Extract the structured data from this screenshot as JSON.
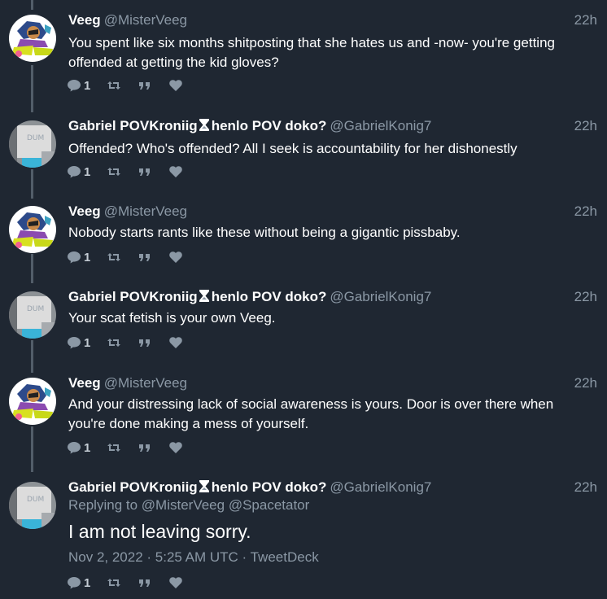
{
  "tweets": [
    {
      "author": "Veeg",
      "handle": "@MisterVeeg",
      "time": "22h",
      "text": "You spent like six months shitposting that she hates us and -now- you're getting offended at getting the kid gloves?",
      "reply_count": "1",
      "avatar": "veeg"
    },
    {
      "author": "Gabriel POVKroniig",
      "author_suffix": "henlo POV doko?",
      "handle": "@GabrielKonig7",
      "time": "22h",
      "text": "Offended? Who's offended? All I seek is accountability for her dishonestly",
      "reply_count": "1",
      "avatar": "gabriel"
    },
    {
      "author": "Veeg",
      "handle": "@MisterVeeg",
      "time": "22h",
      "text": "Nobody starts rants like these without being a gigantic pissbaby.",
      "reply_count": "1",
      "avatar": "veeg"
    },
    {
      "author": "Gabriel POVKroniig",
      "author_suffix": "henlo POV doko?",
      "handle": "@GabrielKonig7",
      "time": "22h",
      "text": "Your scat fetish is your own Veeg.",
      "reply_count": "1",
      "avatar": "gabriel"
    },
    {
      "author": "Veeg",
      "handle": "@MisterVeeg",
      "time": "22h",
      "text": "And your distressing lack of social awareness is yours. Door is over there when you're done making a mess of yourself.",
      "reply_count": "1",
      "avatar": "veeg"
    },
    {
      "author": "Gabriel POVKroniig",
      "author_suffix": "henlo POV doko?",
      "handle": "@GabrielKonig7",
      "time": "22h",
      "replying_label": "Replying to",
      "replying_mentions": "@MisterVeeg @Spacetator",
      "text": "I am not leaving sorry.",
      "meta": "Nov 2, 2022 · 5:25 AM UTC · TweetDeck",
      "reply_count": "1",
      "avatar": "gabriel"
    }
  ],
  "avatar_art_text": "DUM",
  "icons": {
    "reply": "reply-icon",
    "retweet": "retweet-icon",
    "quote": "quote-icon",
    "like": "heart-icon",
    "badge": "hourglass-icon"
  },
  "colors": {
    "background": "#1f2732",
    "text": "#ffffff",
    "secondary": "#8b98a5",
    "thread_line": "#525d69"
  }
}
